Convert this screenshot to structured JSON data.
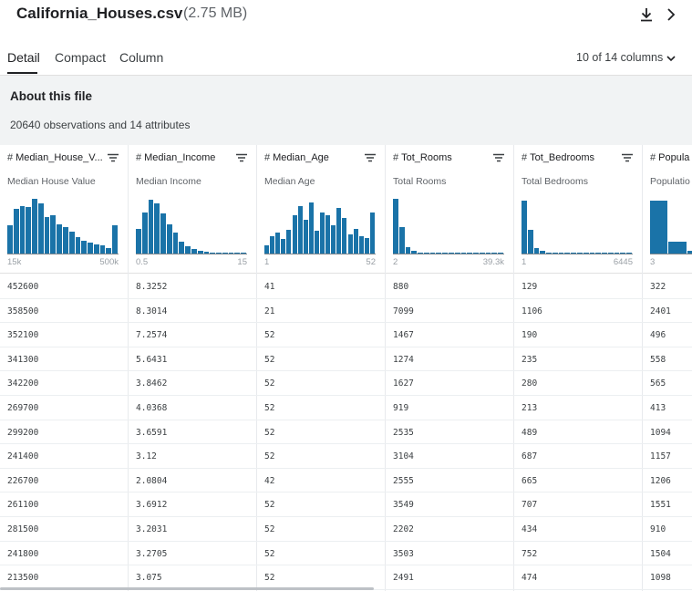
{
  "file": {
    "name": "California_Houses.csv",
    "size": "(2.75 MB)"
  },
  "tabs": [
    {
      "label": "Detail",
      "active": true
    },
    {
      "label": "Compact",
      "active": false
    },
    {
      "label": "Column",
      "active": false
    }
  ],
  "columns_selector": "10 of 14 columns",
  "about": {
    "title": "About this file",
    "description": "20640 observations and 14 attributes"
  },
  "accent_color": "#1a73a8",
  "columns": [
    {
      "name": "Median_House_V...",
      "description": "Median House Value",
      "range_min": "15k",
      "range_max": "500k",
      "hist": [
        0.48,
        0.77,
        0.82,
        0.79,
        0.93,
        0.86,
        0.63,
        0.65,
        0.5,
        0.45,
        0.37,
        0.28,
        0.22,
        0.19,
        0.16,
        0.14,
        0.1,
        0.48
      ],
      "values": [
        "452600",
        "358500",
        "352100",
        "341300",
        "342200",
        "269700",
        "299200",
        "241400",
        "226700",
        "261100",
        "281500",
        "241800",
        "213500"
      ]
    },
    {
      "name": "Median_Income",
      "description": "Median Income",
      "range_min": "0.5",
      "range_max": "15",
      "hist": [
        0.42,
        0.71,
        0.92,
        0.86,
        0.69,
        0.5,
        0.36,
        0.21,
        0.13,
        0.08,
        0.05,
        0.03,
        0.02,
        0.02,
        0.01,
        0.01,
        0.01,
        0.01
      ],
      "values": [
        "8.3252",
        "8.3014",
        "7.2574",
        "5.6431",
        "3.8462",
        "4.0368",
        "3.6591",
        "3.12",
        "2.0804",
        "3.6912",
        "3.2031",
        "3.2705",
        "3.075"
      ]
    },
    {
      "name": "Median_Age",
      "description": "Median Age",
      "range_min": "1",
      "range_max": "52",
      "hist": [
        0.14,
        0.3,
        0.36,
        0.25,
        0.41,
        0.65,
        0.82,
        0.58,
        0.88,
        0.39,
        0.71,
        0.66,
        0.48,
        0.78,
        0.61,
        0.33,
        0.42,
        0.3,
        0.26,
        0.7
      ],
      "values": [
        "41",
        "21",
        "52",
        "52",
        "52",
        "52",
        "52",
        "52",
        "42",
        "52",
        "52",
        "52",
        "52"
      ]
    },
    {
      "name": "Tot_Rooms",
      "description": "Total Rooms",
      "range_min": "2",
      "range_max": "39.3k",
      "hist": [
        0.93,
        0.45,
        0.11,
        0.05,
        0.02,
        0.01,
        0.01,
        0.01,
        0.01,
        0.01,
        0.01,
        0.01,
        0.01,
        0.01,
        0.01,
        0.01,
        0.01,
        0.01
      ],
      "values": [
        "880",
        "7099",
        "1467",
        "1274",
        "1627",
        "919",
        "2535",
        "3104",
        "2555",
        "3549",
        "2202",
        "3503",
        "2491"
      ]
    },
    {
      "name": "Tot_Bedrooms",
      "description": "Total Bedrooms",
      "range_min": "1",
      "range_max": "6445",
      "hist": [
        0.9,
        0.4,
        0.1,
        0.04,
        0.02,
        0.01,
        0.01,
        0.01,
        0.01,
        0.01,
        0.01,
        0.01,
        0.01,
        0.01,
        0.01,
        0.01,
        0.01,
        0.01
      ],
      "values": [
        "129",
        "1106",
        "190",
        "235",
        "280",
        "213",
        "489",
        "687",
        "665",
        "707",
        "434",
        "752",
        "474"
      ]
    },
    {
      "name": "Popula",
      "description": "Populatio",
      "range_min": "3",
      "range_max": "",
      "hist": [
        0.9,
        0.2,
        0.05,
        0.02,
        0.01,
        0.01
      ],
      "values": [
        "322",
        "2401",
        "496",
        "558",
        "565",
        "413",
        "1094",
        "1157",
        "1206",
        "1551",
        "910",
        "1504",
        "1098"
      ]
    }
  ]
}
